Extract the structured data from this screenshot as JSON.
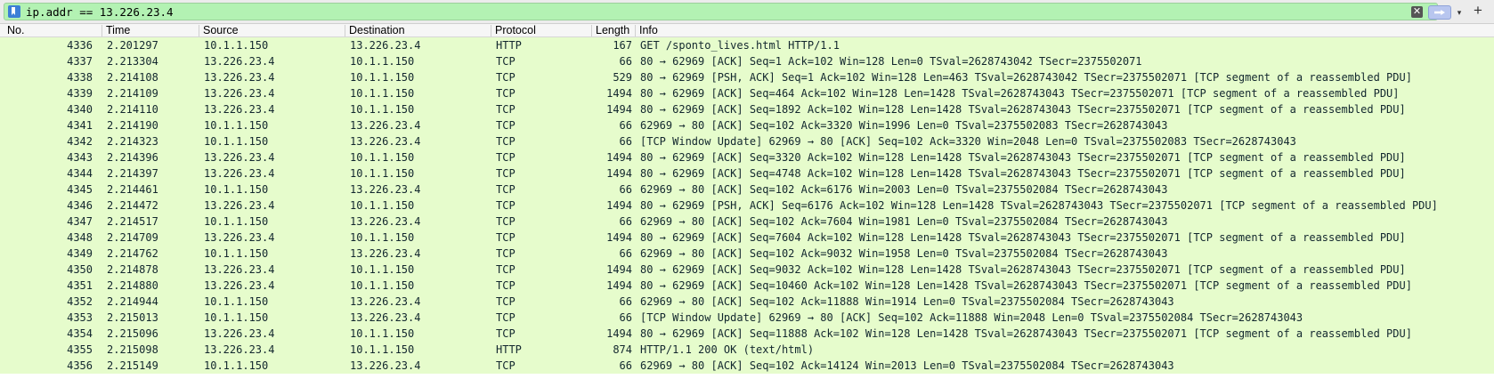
{
  "filter": {
    "value": "ip.addr == 13.226.23.4",
    "icons": {
      "bookmark": "bookmark-icon",
      "clear": "clear-icon",
      "apply": "arrow-right-icon",
      "dropdown": "chevron-down-icon",
      "add": "plus-icon"
    },
    "clear_glyph": "✕",
    "dropdown_glyph": "▾",
    "add_glyph": "+",
    "field_color": "#b3f2b3"
  },
  "columns": {
    "no": "No.",
    "time": "Time",
    "source": "Source",
    "destination": "Destination",
    "protocol": "Protocol",
    "length": "Length",
    "info": "Info"
  },
  "row_color": "#e6fccc",
  "packets": [
    {
      "no": "4336",
      "time": "2.201297",
      "source": "10.1.1.150",
      "destination": "13.226.23.4",
      "protocol": "HTTP",
      "length": "167",
      "info": "GET /sponto_lives.html HTTP/1.1"
    },
    {
      "no": "4337",
      "time": "2.213304",
      "source": "13.226.23.4",
      "destination": "10.1.1.150",
      "protocol": "TCP",
      "length": "66",
      "info": "80 → 62969 [ACK] Seq=1 Ack=102 Win=128 Len=0 TSval=2628743042 TSecr=2375502071"
    },
    {
      "no": "4338",
      "time": "2.214108",
      "source": "13.226.23.4",
      "destination": "10.1.1.150",
      "protocol": "TCP",
      "length": "529",
      "info": "80 → 62969 [PSH, ACK] Seq=1 Ack=102 Win=128 Len=463 TSval=2628743042 TSecr=2375502071 [TCP segment of a reassembled PDU]"
    },
    {
      "no": "4339",
      "time": "2.214109",
      "source": "13.226.23.4",
      "destination": "10.1.1.150",
      "protocol": "TCP",
      "length": "1494",
      "info": "80 → 62969 [ACK] Seq=464 Ack=102 Win=128 Len=1428 TSval=2628743043 TSecr=2375502071 [TCP segment of a reassembled PDU]"
    },
    {
      "no": "4340",
      "time": "2.214110",
      "source": "13.226.23.4",
      "destination": "10.1.1.150",
      "protocol": "TCP",
      "length": "1494",
      "info": "80 → 62969 [ACK] Seq=1892 Ack=102 Win=128 Len=1428 TSval=2628743043 TSecr=2375502071 [TCP segment of a reassembled PDU]"
    },
    {
      "no": "4341",
      "time": "2.214190",
      "source": "10.1.1.150",
      "destination": "13.226.23.4",
      "protocol": "TCP",
      "length": "66",
      "info": "62969 → 80 [ACK] Seq=102 Ack=3320 Win=1996 Len=0 TSval=2375502083 TSecr=2628743043"
    },
    {
      "no": "4342",
      "time": "2.214323",
      "source": "10.1.1.150",
      "destination": "13.226.23.4",
      "protocol": "TCP",
      "length": "66",
      "info": "[TCP Window Update] 62969 → 80 [ACK] Seq=102 Ack=3320 Win=2048 Len=0 TSval=2375502083 TSecr=2628743043"
    },
    {
      "no": "4343",
      "time": "2.214396",
      "source": "13.226.23.4",
      "destination": "10.1.1.150",
      "protocol": "TCP",
      "length": "1494",
      "info": "80 → 62969 [ACK] Seq=3320 Ack=102 Win=128 Len=1428 TSval=2628743043 TSecr=2375502071 [TCP segment of a reassembled PDU]"
    },
    {
      "no": "4344",
      "time": "2.214397",
      "source": "13.226.23.4",
      "destination": "10.1.1.150",
      "protocol": "TCP",
      "length": "1494",
      "info": "80 → 62969 [ACK] Seq=4748 Ack=102 Win=128 Len=1428 TSval=2628743043 TSecr=2375502071 [TCP segment of a reassembled PDU]"
    },
    {
      "no": "4345",
      "time": "2.214461",
      "source": "10.1.1.150",
      "destination": "13.226.23.4",
      "protocol": "TCP",
      "length": "66",
      "info": "62969 → 80 [ACK] Seq=102 Ack=6176 Win=2003 Len=0 TSval=2375502084 TSecr=2628743043"
    },
    {
      "no": "4346",
      "time": "2.214472",
      "source": "13.226.23.4",
      "destination": "10.1.1.150",
      "protocol": "TCP",
      "length": "1494",
      "info": "80 → 62969 [PSH, ACK] Seq=6176 Ack=102 Win=128 Len=1428 TSval=2628743043 TSecr=2375502071 [TCP segment of a reassembled PDU]"
    },
    {
      "no": "4347",
      "time": "2.214517",
      "source": "10.1.1.150",
      "destination": "13.226.23.4",
      "protocol": "TCP",
      "length": "66",
      "info": "62969 → 80 [ACK] Seq=102 Ack=7604 Win=1981 Len=0 TSval=2375502084 TSecr=2628743043"
    },
    {
      "no": "4348",
      "time": "2.214709",
      "source": "13.226.23.4",
      "destination": "10.1.1.150",
      "protocol": "TCP",
      "length": "1494",
      "info": "80 → 62969 [ACK] Seq=7604 Ack=102 Win=128 Len=1428 TSval=2628743043 TSecr=2375502071 [TCP segment of a reassembled PDU]"
    },
    {
      "no": "4349",
      "time": "2.214762",
      "source": "10.1.1.150",
      "destination": "13.226.23.4",
      "protocol": "TCP",
      "length": "66",
      "info": "62969 → 80 [ACK] Seq=102 Ack=9032 Win=1958 Len=0 TSval=2375502084 TSecr=2628743043"
    },
    {
      "no": "4350",
      "time": "2.214878",
      "source": "13.226.23.4",
      "destination": "10.1.1.150",
      "protocol": "TCP",
      "length": "1494",
      "info": "80 → 62969 [ACK] Seq=9032 Ack=102 Win=128 Len=1428 TSval=2628743043 TSecr=2375502071 [TCP segment of a reassembled PDU]"
    },
    {
      "no": "4351",
      "time": "2.214880",
      "source": "13.226.23.4",
      "destination": "10.1.1.150",
      "protocol": "TCP",
      "length": "1494",
      "info": "80 → 62969 [ACK] Seq=10460 Ack=102 Win=128 Len=1428 TSval=2628743043 TSecr=2375502071 [TCP segment of a reassembled PDU]"
    },
    {
      "no": "4352",
      "time": "2.214944",
      "source": "10.1.1.150",
      "destination": "13.226.23.4",
      "protocol": "TCP",
      "length": "66",
      "info": "62969 → 80 [ACK] Seq=102 Ack=11888 Win=1914 Len=0 TSval=2375502084 TSecr=2628743043"
    },
    {
      "no": "4353",
      "time": "2.215013",
      "source": "10.1.1.150",
      "destination": "13.226.23.4",
      "protocol": "TCP",
      "length": "66",
      "info": "[TCP Window Update] 62969 → 80 [ACK] Seq=102 Ack=11888 Win=2048 Len=0 TSval=2375502084 TSecr=2628743043"
    },
    {
      "no": "4354",
      "time": "2.215096",
      "source": "13.226.23.4",
      "destination": "10.1.1.150",
      "protocol": "TCP",
      "length": "1494",
      "info": "80 → 62969 [ACK] Seq=11888 Ack=102 Win=128 Len=1428 TSval=2628743043 TSecr=2375502071 [TCP segment of a reassembled PDU]"
    },
    {
      "no": "4355",
      "time": "2.215098",
      "source": "13.226.23.4",
      "destination": "10.1.1.150",
      "protocol": "HTTP",
      "length": "874",
      "info": "HTTP/1.1 200 OK  (text/html)"
    },
    {
      "no": "4356",
      "time": "2.215149",
      "source": "10.1.1.150",
      "destination": "13.226.23.4",
      "protocol": "TCP",
      "length": "66",
      "info": "62969 → 80 [ACK] Seq=102 Ack=14124 Win=2013 Len=0 TSval=2375502084 TSecr=2628743043"
    }
  ]
}
